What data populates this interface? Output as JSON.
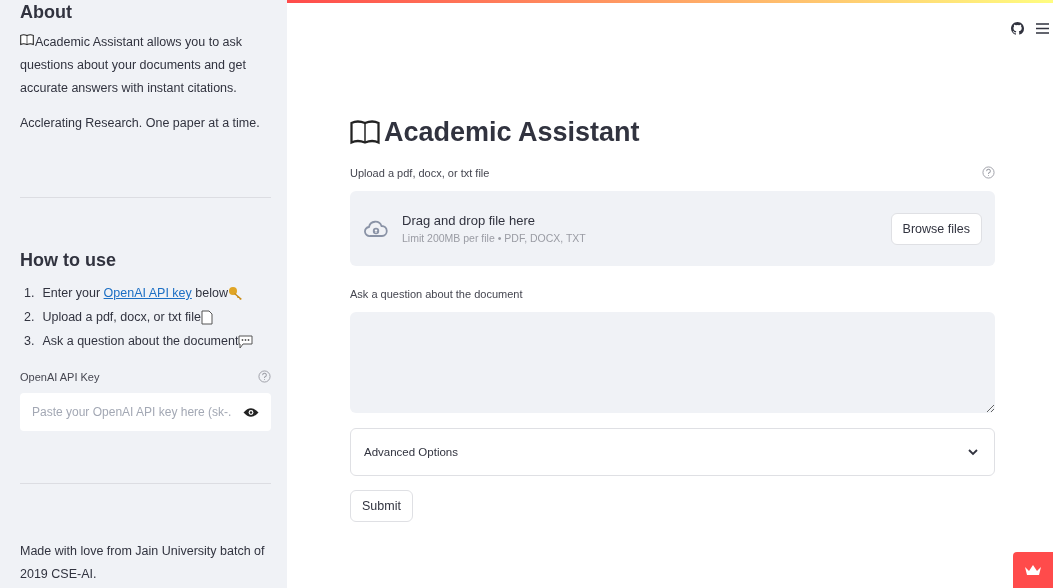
{
  "sidebar": {
    "about_title": "About",
    "about_text": "Academic Assistant allows you to ask questions about your documents and get accurate answers with instant citations.",
    "tagline": "Acclerating Research. One paper at a time.",
    "howto_title": "How to use",
    "steps": [
      {
        "number": "1.",
        "before": "Enter your ",
        "link": "OpenAI API key",
        "after": " below"
      },
      {
        "number": "2.",
        "before": "Upload a pdf, docx, or txt file"
      },
      {
        "number": "3.",
        "before": "Ask a question about the document"
      }
    ],
    "api_key": {
      "label": "OpenAI API Key",
      "placeholder": "Paste your OpenAI API key here (sk-."
    },
    "footer": "Made with love from Jain University batch of 2019 CSE-AI."
  },
  "main": {
    "title": "Academic Assistant",
    "upload": {
      "label": "Upload a pdf, docx, or txt file",
      "drop_text": "Drag and drop file here",
      "limit": "Limit 200MB per file • PDF, DOCX, TXT",
      "button": "Browse files"
    },
    "question": {
      "label": "Ask a question about the document"
    },
    "advanced": {
      "label": "Advanced Options",
      "expanded": false
    },
    "submit": "Submit"
  }
}
